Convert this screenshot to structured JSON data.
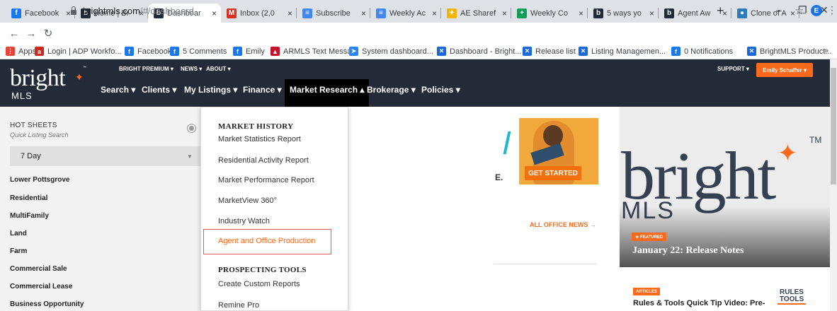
{
  "browser": {
    "tabs": [
      {
        "label": "Facebook",
        "icon": "facebook-icon",
        "color": "#1877f2",
        "glyph": "f"
      },
      {
        "label": "Home | Br",
        "icon": "bright-icon",
        "color": "#232b39",
        "glyph": "b"
      },
      {
        "label": "Dashboar",
        "icon": "bright-icon",
        "color": "#232b39",
        "glyph": "b",
        "active": true
      },
      {
        "label": "Inbox (2,0",
        "icon": "gmail-icon",
        "color": "#d93025",
        "glyph": "M"
      },
      {
        "label": "Subscribe",
        "icon": "doc-icon",
        "color": "#4285f4",
        "glyph": "≡"
      },
      {
        "label": "Weekly Ac",
        "icon": "doc-icon",
        "color": "#4285f4",
        "glyph": "≡"
      },
      {
        "label": "AE Sharef",
        "icon": "leaf-icon",
        "color": "#f4b400",
        "glyph": "✦"
      },
      {
        "label": "Weekly Co",
        "icon": "sheet-icon",
        "color": "#0f9d58",
        "glyph": "+"
      },
      {
        "label": "5 ways yo",
        "icon": "bright-icon",
        "color": "#232b39",
        "glyph": "b"
      },
      {
        "label": "Agent Aw",
        "icon": "bright-icon",
        "color": "#232b39",
        "glyph": "b"
      },
      {
        "label": "Clone of A",
        "icon": "clone-icon",
        "color": "#2b7bb9",
        "glyph": "●"
      }
    ],
    "tab_close": "×",
    "new_tab": "+",
    "window": {
      "minimize": "–",
      "restore": "❐",
      "close": "✕"
    },
    "url_domain": "brightmls.com",
    "url_path": "/#/dashboard",
    "profile_initial": "E",
    "bookmarks": [
      {
        "label": "Apps",
        "icon": "apps-icon",
        "color": "#ea4335",
        "glyph": "⋮"
      },
      {
        "label": "Login | ADP Workfo...",
        "icon": "adp-icon",
        "color": "#d0271d",
        "glyph": "a"
      },
      {
        "label": "Facebook",
        "icon": "facebook-icon",
        "color": "#1877f2",
        "glyph": "f"
      },
      {
        "label": "5 Comments",
        "icon": "facebook-icon",
        "color": "#1877f2",
        "glyph": "f"
      },
      {
        "label": "Emily",
        "icon": "facebook-icon",
        "color": "#1877f2",
        "glyph": "f"
      },
      {
        "label": "ARMLS Text Messa...",
        "icon": "armls-icon",
        "color": "#c8102e",
        "glyph": "▲"
      },
      {
        "label": "System dashboard...",
        "icon": "jira-icon",
        "color": "#2684ff",
        "glyph": "➤"
      },
      {
        "label": "Dashboard - Bright...",
        "icon": "confluence-icon",
        "color": "#1868db",
        "glyph": "✕"
      },
      {
        "label": "Release list",
        "icon": "confluence-icon",
        "color": "#1868db",
        "glyph": "✕"
      },
      {
        "label": "Listing Managemen...",
        "icon": "confluence-icon",
        "color": "#1868db",
        "glyph": "✕"
      },
      {
        "label": "0 Notifications",
        "icon": "facebook-icon",
        "color": "#1877f2",
        "glyph": "f"
      },
      {
        "label": "BrightMLS Product...",
        "icon": "confluence-icon",
        "color": "#1868db",
        "glyph": "✕"
      }
    ],
    "bookmarks_more": "»"
  },
  "site": {
    "logo_text": "bright",
    "logo_sub": "MLS",
    "logo_tm": "™",
    "top_nav": [
      "BRIGHT PREMIUM ▾",
      "NEWS ▾",
      "ABOUT ▾"
    ],
    "main_nav": [
      "Search ▾",
      "Clients ▾",
      "My Listings ▾",
      "Finance ▾",
      "Market Research ▴",
      "Brokerage ▾",
      "Policies ▾"
    ],
    "support": "SUPPORT ▾",
    "user": "Emily Schaffer ▾",
    "colors": {
      "header": "#232b39",
      "accent": "#ff6a1a"
    }
  },
  "sidebar": {
    "title": "HOT SHEETS",
    "subtitle": "Quick Listing Search",
    "select_value": "7 Day",
    "items": [
      "Lower Pottsgrove",
      "Residential",
      "MultiFamily",
      "Land",
      "Farm",
      "Commercial Sale",
      "Commercial Lease",
      "Business Opportunity"
    ]
  },
  "dropdown": {
    "sections": [
      {
        "heading": "MARKET HISTORY",
        "items": [
          "Market Statistics Report",
          "Residential Activity Report",
          "Market Performance Report",
          "MarketView 360°",
          "Industry Watch",
          "Agent and Office Production"
        ]
      },
      {
        "heading": "PROSPECTING TOOLS",
        "items": [
          "Create Custom Reports",
          "Remine Pro"
        ]
      }
    ]
  },
  "main": {
    "promo_cta": "GET STARTED",
    "promo_fragment": "E.",
    "office_news_link": "ALL OFFICE NEWS →"
  },
  "right": {
    "hero_logo": "bright",
    "hero_mls": "MLS",
    "hero_tm": "TM",
    "featured_badge": "★ FEATURED",
    "featured_title": "January 22: Release Notes",
    "articles_badge": "ARTICLES",
    "article_title": "Rules & Tools Quick Tip Video: Pre-",
    "tools_label": "RULES TOOLS"
  }
}
